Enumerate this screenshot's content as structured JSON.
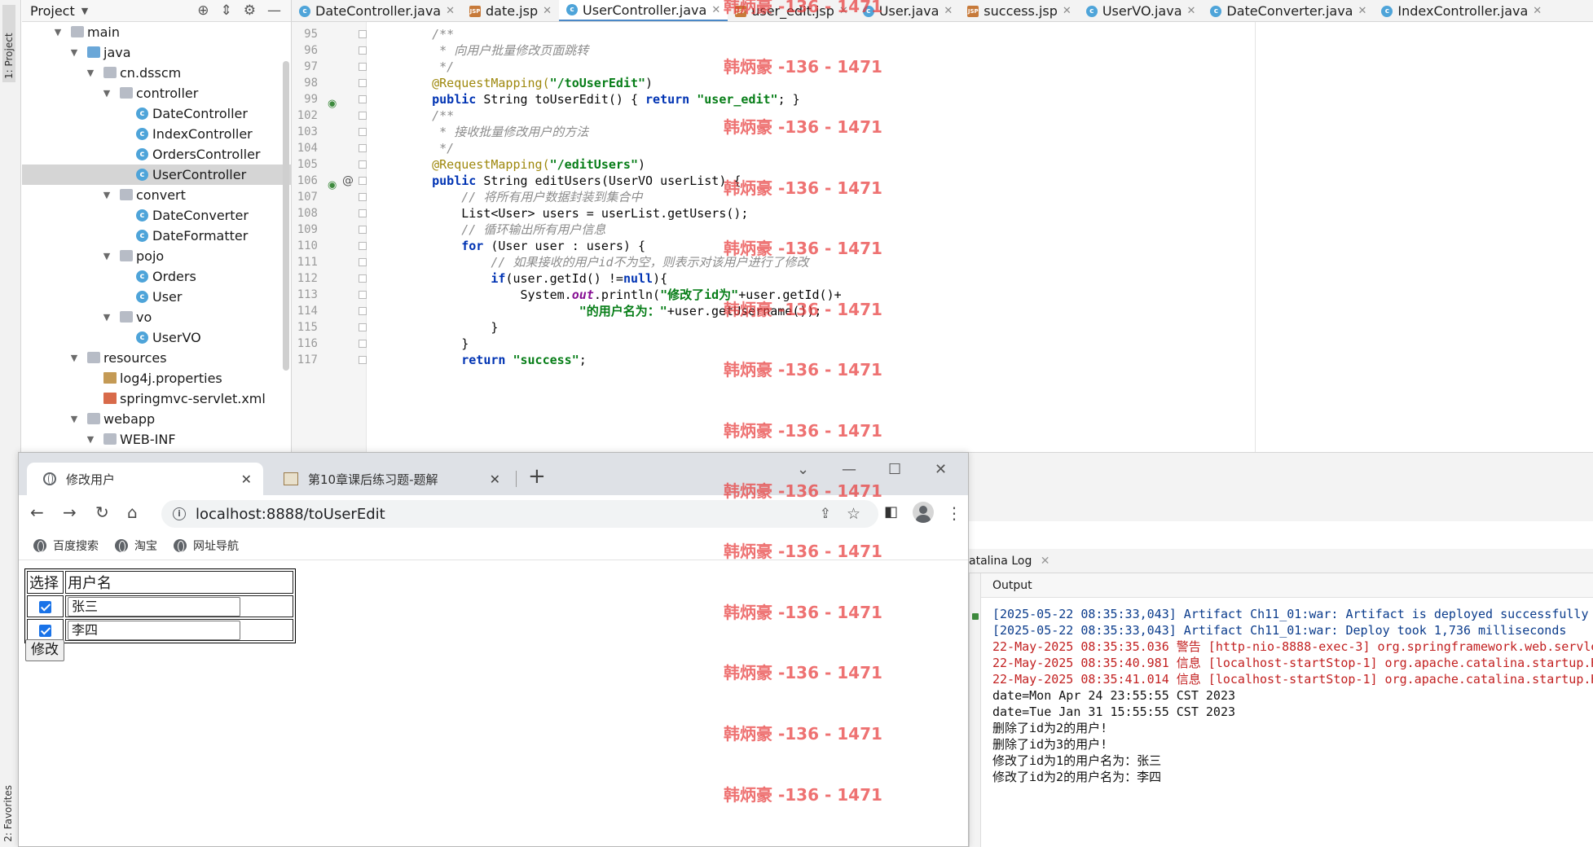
{
  "sidebar_tabs": {
    "project": "1: Project",
    "favorites": "2: Favorites"
  },
  "project_panel": {
    "title": "Project",
    "tree": [
      {
        "label": "main",
        "indent": 0,
        "icon": "folder",
        "expanded": true
      },
      {
        "label": "java",
        "indent": 1,
        "icon": "folder-blue",
        "expanded": true
      },
      {
        "label": "cn.dsscm",
        "indent": 2,
        "icon": "package",
        "expanded": true
      },
      {
        "label": "controller",
        "indent": 3,
        "icon": "package",
        "expanded": true
      },
      {
        "label": "DateController",
        "indent": 4,
        "icon": "class"
      },
      {
        "label": "IndexController",
        "indent": 4,
        "icon": "class"
      },
      {
        "label": "OrdersController",
        "indent": 4,
        "icon": "class"
      },
      {
        "label": "UserController",
        "indent": 4,
        "icon": "class",
        "selected": true
      },
      {
        "label": "convert",
        "indent": 3,
        "icon": "package",
        "expanded": true
      },
      {
        "label": "DateConverter",
        "indent": 4,
        "icon": "class"
      },
      {
        "label": "DateFormatter",
        "indent": 4,
        "icon": "class"
      },
      {
        "label": "pojo",
        "indent": 3,
        "icon": "package",
        "expanded": true
      },
      {
        "label": "Orders",
        "indent": 4,
        "icon": "class"
      },
      {
        "label": "User",
        "indent": 4,
        "icon": "class"
      },
      {
        "label": "vo",
        "indent": 3,
        "icon": "package",
        "expanded": true
      },
      {
        "label": "UserVO",
        "indent": 4,
        "icon": "class"
      },
      {
        "label": "resources",
        "indent": 1,
        "icon": "folder",
        "expanded": true
      },
      {
        "label": "log4j.properties",
        "indent": 2,
        "icon": "file"
      },
      {
        "label": "springmvc-servlet.xml",
        "indent": 2,
        "icon": "xml"
      },
      {
        "label": "webapp",
        "indent": 1,
        "icon": "folder",
        "expanded": true
      },
      {
        "label": "WEB-INF",
        "indent": 2,
        "icon": "folder",
        "expanded": true
      }
    ]
  },
  "editor_tabs": [
    {
      "label": "DateController.java",
      "icon": "class"
    },
    {
      "label": "date.jsp",
      "icon": "jsp"
    },
    {
      "label": "UserController.java",
      "icon": "class",
      "active": true
    },
    {
      "label": "user_edit.jsp",
      "icon": "jsp"
    },
    {
      "label": "User.java",
      "icon": "class"
    },
    {
      "label": "success.jsp",
      "icon": "jsp"
    },
    {
      "label": "UserVO.java",
      "icon": "class"
    },
    {
      "label": "DateConverter.java",
      "icon": "class"
    },
    {
      "label": "IndexController.java",
      "icon": "class"
    }
  ],
  "code_lines": [
    {
      "n": "95",
      "parts": [
        [
          "    /**",
          "com"
        ]
      ]
    },
    {
      "n": "96",
      "parts": [
        [
          "     * 向用户批量修改页面跳转",
          "com"
        ]
      ]
    },
    {
      "n": "97",
      "parts": [
        [
          "     */",
          "com"
        ]
      ]
    },
    {
      "n": "98",
      "parts": [
        [
          "    @RequestMapping(",
          "ann"
        ],
        [
          "\"/toUserEdit\"",
          "str"
        ],
        [
          ")",
          ""
        ]
      ]
    },
    {
      "n": "99",
      "mark": "bean",
      "parts": [
        [
          "    ",
          ""
        ],
        [
          "public",
          "kw"
        ],
        [
          " String toUserEdit() { ",
          ""
        ],
        [
          "return",
          "kw"
        ],
        [
          " ",
          ""
        ],
        [
          "\"user_edit\"",
          "str"
        ],
        [
          "; }",
          ""
        ]
      ]
    },
    {
      "n": "102",
      "parts": [
        [
          "    /**",
          "com"
        ]
      ]
    },
    {
      "n": "103",
      "parts": [
        [
          "     * 接收批量修改用户的方法",
          "com"
        ]
      ]
    },
    {
      "n": "104",
      "parts": [
        [
          "     */",
          "com"
        ]
      ]
    },
    {
      "n": "105",
      "parts": [
        [
          "    @RequestMapping(",
          "ann"
        ],
        [
          "\"/editUsers\"",
          "str"
        ],
        [
          ")",
          ""
        ]
      ]
    },
    {
      "n": "106",
      "mark": "bean-at",
      "parts": [
        [
          "    ",
          ""
        ],
        [
          "public",
          "kw"
        ],
        [
          " String editUsers(UserVO userList) {",
          ""
        ]
      ]
    },
    {
      "n": "107",
      "parts": [
        [
          "        // 将所有用户数据封装到集合中",
          "com"
        ]
      ]
    },
    {
      "n": "108",
      "parts": [
        [
          "        List<User> users = userList.getUsers();",
          ""
        ]
      ]
    },
    {
      "n": "109",
      "parts": [
        [
          "        // 循环输出所有用户信息",
          "com"
        ]
      ]
    },
    {
      "n": "110",
      "parts": [
        [
          "        ",
          ""
        ],
        [
          "for",
          "kw"
        ],
        [
          " (User user : users) {",
          ""
        ]
      ]
    },
    {
      "n": "111",
      "parts": [
        [
          "            // 如果接收的用户id不为空，则表示对该用户进行了修改",
          "com"
        ]
      ]
    },
    {
      "n": "112",
      "parts": [
        [
          "            ",
          ""
        ],
        [
          "if",
          "kw"
        ],
        [
          "(user.getId() !=",
          ""
        ],
        [
          "null",
          "kw"
        ],
        [
          "){",
          ""
        ]
      ]
    },
    {
      "n": "113",
      "parts": [
        [
          "                System.",
          ""
        ],
        [
          "out",
          "fld"
        ],
        [
          ".println(",
          ""
        ],
        [
          "\"修改了id为\"",
          "str"
        ],
        [
          "+user.getId()+",
          ""
        ]
      ]
    },
    {
      "n": "114",
      "parts": [
        [
          "                        ",
          ""
        ],
        [
          "\"的用户名为：\"",
          "str"
        ],
        [
          "+user.getUsername());",
          ""
        ]
      ]
    },
    {
      "n": "115",
      "parts": [
        [
          "            }",
          ""
        ]
      ]
    },
    {
      "n": "116",
      "parts": [
        [
          "        }",
          ""
        ]
      ]
    },
    {
      "n": "117",
      "parts": [
        [
          "        ",
          ""
        ],
        [
          "return",
          "kw"
        ],
        [
          " ",
          ""
        ],
        [
          "\"success\"",
          "str"
        ],
        [
          ";",
          ""
        ]
      ]
    }
  ],
  "log_panel": {
    "tab_label": "atalina Log",
    "output_label": "Output",
    "lines": [
      {
        "text": "[2025-05-22 08:35:33,043] Artifact Ch11_01:war: Artifact is deployed successfully",
        "color": "blue"
      },
      {
        "text": "[2025-05-22 08:35:33,043] Artifact Ch11_01:war: Deploy took 1,736 milliseconds",
        "color": "blue"
      },
      {
        "text": "22-May-2025 08:35:35.036 警告 [http-nio-8888-exec-3] org.springframework.web.servle",
        "color": "red"
      },
      {
        "text": "22-May-2025 08:35:40.981 信息 [localhost-startStop-1] org.apache.catalina.startup.H",
        "color": "red"
      },
      {
        "text": "22-May-2025 08:35:41.014 信息 [localhost-startStop-1] org.apache.catalina.startup.H",
        "color": "red"
      },
      {
        "text": "date=Mon Apr 24 23:55:55 CST 2023",
        "color": "black"
      },
      {
        "text": "date=Tue Jan 31 15:55:55 CST 2023",
        "color": "black"
      },
      {
        "text": "删除了id为2的用户!",
        "color": "black"
      },
      {
        "text": "删除了id为3的用户!",
        "color": "black"
      },
      {
        "text": "修改了id为1的用户名为：张三",
        "color": "black"
      },
      {
        "text": "修改了id为2的用户名为：李四",
        "color": "black"
      }
    ]
  },
  "browser": {
    "tabs": [
      {
        "label": "修改用户",
        "active": true
      },
      {
        "label": "第10章课后练习题-题解",
        "active": false
      }
    ],
    "url": "localhost:8888/toUserEdit",
    "bookmarks": [
      "百度搜索",
      "淘宝",
      "网址导航"
    ],
    "page": {
      "headers": [
        "选择",
        "用户名"
      ],
      "rows": [
        {
          "checked": true,
          "username": "张三"
        },
        {
          "checked": true,
          "username": "李四"
        }
      ],
      "submit_label": "修改"
    }
  },
  "watermark": {
    "text": "韩炳豪 -136 - 1471",
    "color": "#e83c3c"
  }
}
